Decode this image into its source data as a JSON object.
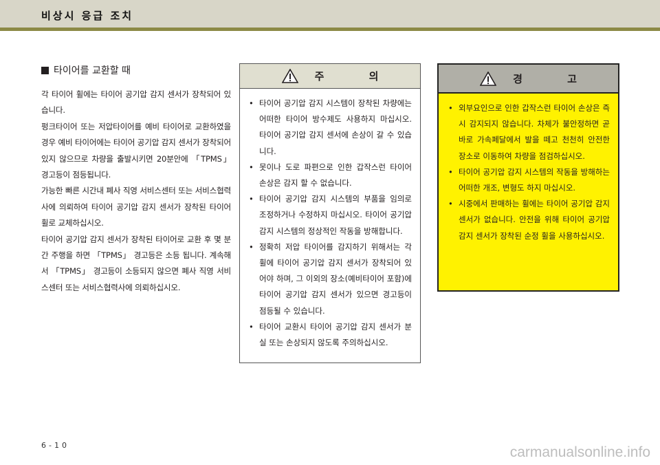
{
  "header": {
    "title": "비상시 응급 조치"
  },
  "section": {
    "heading": "타이어를 교환할 때",
    "paragraphs": [
      "각 타이어 휠에는 타이어 공기압 감지 센서가 장착되어 있습니다.",
      "펑크타이어 또는 저압타이어를 예비 타이어로 교환하였을 경우 예비 타이어에는 타이어 공기압 감지 센서가 장착되어 있지 않으므로 차량을 출발시키면 20분안에 「TPMS」 경고등이 점등됩니다.",
      "가능한 빠른 시간내 폐사 직영 서비스센터 또는 서비스협력사에 의뢰하여 타이어 공기압 감지 센서가 장착된 타이어 휠로 교체하십시오.",
      "타이어 공기압 감지 센서가 장착된 타이어로 교환 후 몇 분간 주행을 하면 「TPMS」 경고등은 소등 됩니다. 계속해서 「TPMS」 경고등이 소등되지 않으면 폐사 직영 서비스센터 또는 서비스협력사에 의뢰하십시오."
    ]
  },
  "caution": {
    "title": "주 의",
    "icon": "warning-triangle-icon",
    "items": [
      "타이어 공기압 감지 시스템이 장착된 차량에는 어떠한 타이어 방수제도 사용하지 마십시오. 타이어 공기압 감지 센서에 손상이 갈 수 있습니다.",
      "못이나 도로 파편으로 인한 갑작스런 타이어 손상은 감지 할 수 없습니다.",
      "타이어 공기압 감지 시스템의 부품을 임의로 조정하거나 수정하지 마십시오. 타이어 공기압 감지 시스템의 정상적인 작동을 방해합니다.",
      "정확히 저압 타이어를 감지하기 위해서는 각 휠에 타이어 공기압 감지 센서가 장착되어 있어야 하며, 그 이외의 장소(예비타이어 포함)에 타이어 공기압 감지 센서가 있으면 경고등이 점등될 수 있습니다.",
      "타이어 교환시 타이어 공기압 감지 센서가 분실 또는 손상되지 않도록 주의하십시오."
    ]
  },
  "warning": {
    "title": "경 고",
    "icon": "warning-triangle-icon",
    "items": [
      "외부요인으로 인한 갑작스런 타이어 손상은 즉시 감지되지 않습니다. 차체가 불안정하면 곧바로 가속페달에서 발을 떼고 천천히 안전한 장소로 이동하여 차량을 점검하십시오.",
      "타이어 공기압 감지 시스템의 작동을 방해하는 어떠한 개조, 변형도 하지 마십시오.",
      "시중에서 판매하는 휠에는 타이어 공기압 감지센서가 없습니다. 안전을 위해 타이어 공기압 감지 센서가 장착된 순정 휠을 사용하십시오."
    ]
  },
  "footer": {
    "page_number": "6-10",
    "watermark": "carmanualsonline.info"
  },
  "colors": {
    "warning_fill": "#fff200",
    "caution_header": "#e0dfd0",
    "warning_header": "#b0afa7",
    "header_rule": "#8c8a46"
  }
}
